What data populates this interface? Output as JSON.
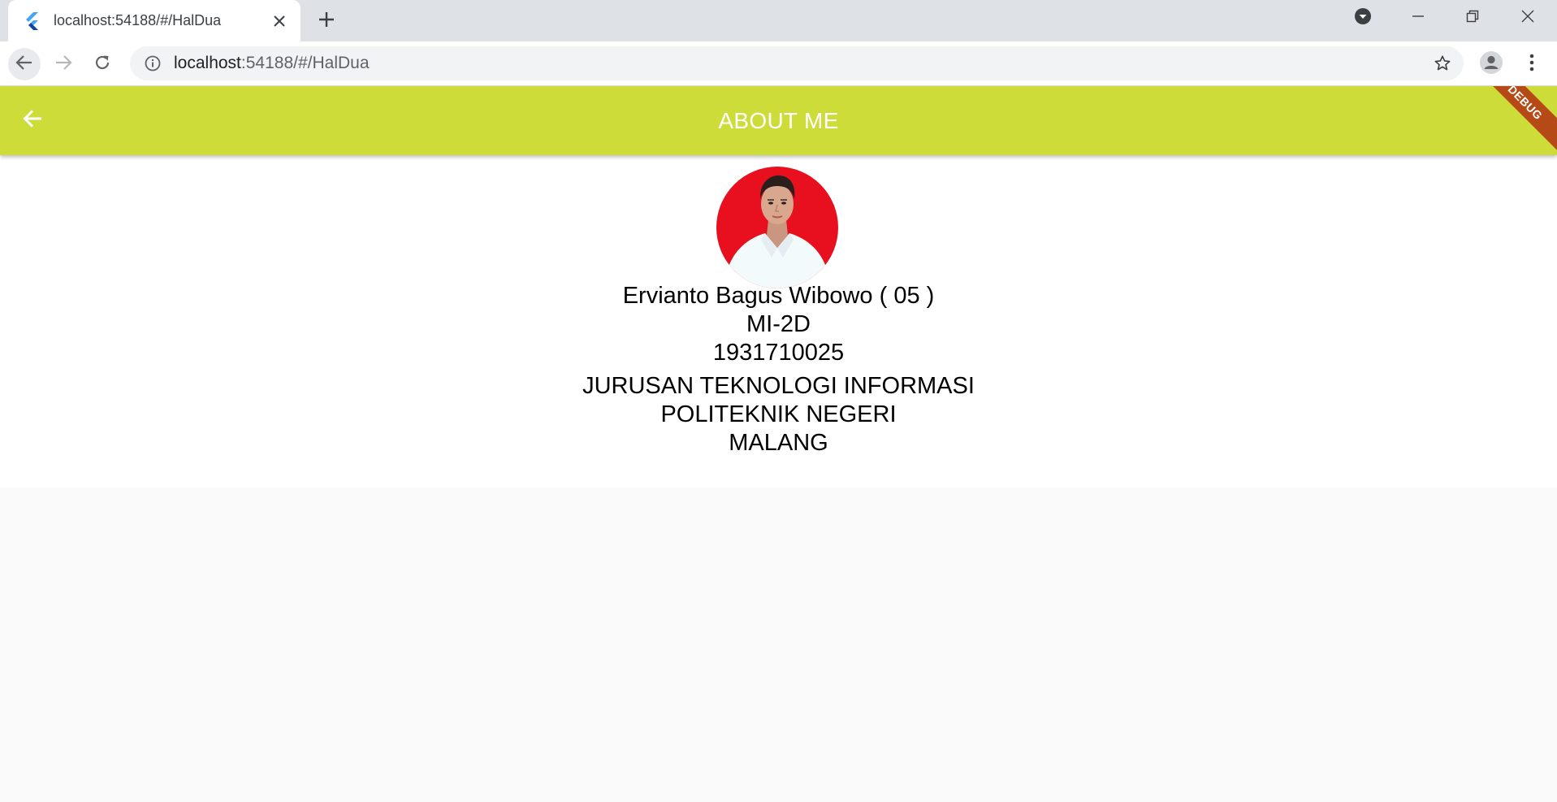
{
  "browser": {
    "tab": {
      "title": "localhost:54188/#/HalDua",
      "favicon": "flutter-logo-icon"
    },
    "new_tab_icon": "plus-icon",
    "window_controls": [
      "minimize-icon",
      "restore-icon",
      "close-icon"
    ],
    "address_bar": {
      "host": "localhost",
      "rest": ":54188/#/HalDua",
      "info_icon": "info-icon",
      "bookmark_icon": "star-icon"
    },
    "nav": [
      "back-arrow-icon",
      "forward-arrow-icon",
      "reload-icon"
    ],
    "profile_icon": "person-icon",
    "menu_icon": "more-vert-icon"
  },
  "app": {
    "appbar": {
      "title": "ABOUT ME",
      "back_icon": "arrow-back-icon",
      "color": "#cddc39"
    },
    "debug_banner": "DEBUG",
    "profile": {
      "photo_icon": "profile-photo",
      "name": "Ervianto Bagus Wibowo ( 05 )",
      "class": "MI-2D",
      "nim": "1931710025",
      "department": "JURUSAN TEKNOLOGI INFORMASI",
      "institution_line1": "POLITEKNIK NEGERI",
      "institution_line2": "MALANG"
    }
  },
  "colors": {
    "appbar": "#cddc39",
    "debug_banner": "#b03010",
    "photo_background": "#e8101f"
  }
}
